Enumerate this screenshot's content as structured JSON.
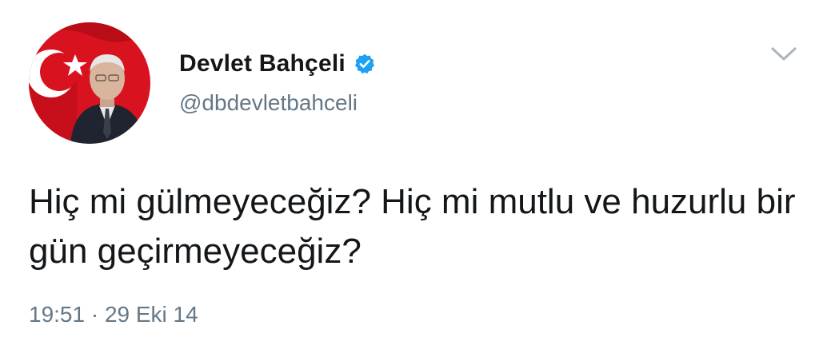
{
  "author": {
    "display_name": "Devlet Bahçeli",
    "handle": "@dbdevletbahceli",
    "verified": true,
    "verified_icon": "verified-badge-icon",
    "verified_color": "#1da1f2"
  },
  "tweet": {
    "text": "Hiç mi gülmeyeceğiz? Hiç mi mutlu ve huzurlu bir gün geçirmeyeceğiz?",
    "timestamp": "19:51 · 29 Eki 14"
  },
  "menu": {
    "icon": "chevron-down-icon"
  },
  "colors": {
    "name": "#14171a",
    "secondary": "#657786",
    "flag_red": "#e30a17"
  }
}
